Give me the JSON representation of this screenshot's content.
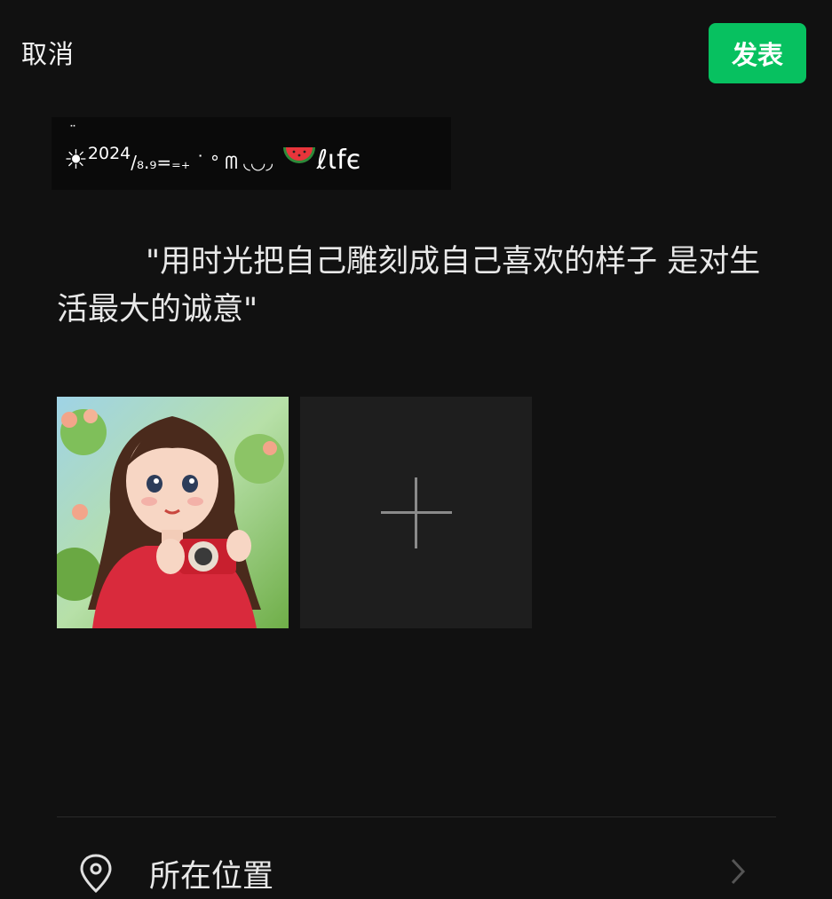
{
  "header": {
    "cancel_label": "取消",
    "publish_label": "发表"
  },
  "post": {
    "deco_prefix": "☀",
    "deco_dots": "¨",
    "deco_year": "2024",
    "deco_mid": "/₈.₉=₌₊ ˙ ° ᗰ ◟◡◞",
    "deco_life": "ℓιfє",
    "text": "\"用时光把自己雕刻成自己喜欢的样子 是对生活最大的诚意\""
  },
  "media": {
    "photo_description_icon": "girl-with-camera-photo",
    "add_icon": "plus-icon"
  },
  "location": {
    "label": "所在位置",
    "icon": "location-pin-icon",
    "chevron": "chevron-right-icon"
  },
  "colors": {
    "accent": "#07c160",
    "background": "#111111"
  }
}
